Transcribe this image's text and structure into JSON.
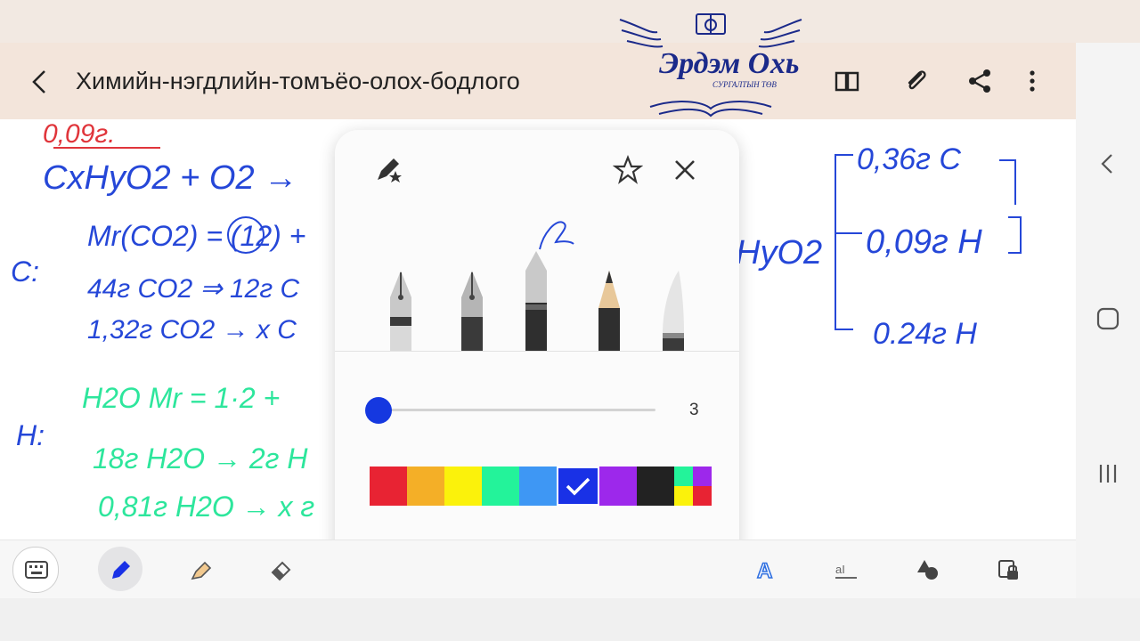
{
  "app": {
    "doc_title": "Химийн-нэгдлийн-томъёо-олох-бодлого"
  },
  "header_icons": [
    "back-icon",
    "book-icon",
    "paperclip-icon",
    "share-icon",
    "more-vertical-icon"
  ],
  "logo": {
    "name_text": "Эрдэм Охь",
    "sub_text": "СУРГАЛТЫН ТӨВ"
  },
  "pen_popup": {
    "pen_types": [
      "fountain-pen",
      "calligraphy-pen",
      "ballpoint-pen",
      "pencil",
      "marker"
    ],
    "selected_pen": "ballpoint-pen",
    "size_value": "3",
    "size_fraction": 0.0,
    "colors": [
      "#e82333",
      "#f4af27",
      "#fbf20b",
      "#23f39a",
      "#3e97f4",
      "#1931e6",
      "#9d28eb",
      "#222222"
    ],
    "selected_color": "#1931e6",
    "multi_color": [
      "#23f39a",
      "#9d28eb",
      "#fbf20b",
      "#e82333"
    ],
    "page_dots": 4,
    "active_dot": 0
  },
  "toolbar": {
    "tools": [
      "keyboard-icon",
      "pen-icon",
      "highlighter-icon",
      "eraser-icon",
      "text-style-icon",
      "text-resize-icon",
      "shapes-icon",
      "lock-icon"
    ],
    "active_tool": "pen-icon"
  },
  "handwriting": {
    "line1": "0,09г.",
    "line2": "CxHyO2 + O2 →",
    "line3": "Mr(CO2) = (12) + ",
    "c_label": "C:",
    "line4": "44г CO2 ⇒ 12г C",
    "line5": "1,32г CO2 → x C",
    "h2o": "H2O  Mr = 1·2 +",
    "h_label": "H:",
    "line6": "18г H2O → 2г H",
    "line7": "0,81г H2O → x г",
    "right1": "0,36г C",
    "right2": "0,09г H",
    "right3": "0.24г H",
    "right_formula": "HyO2"
  }
}
